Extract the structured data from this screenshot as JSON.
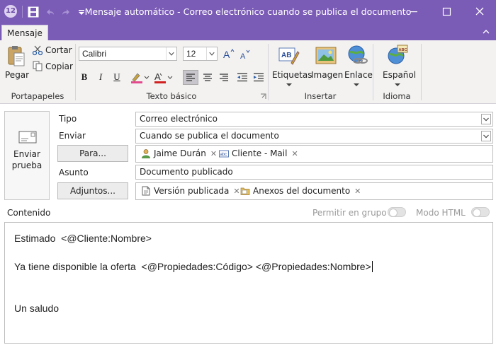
{
  "window": {
    "title": "Mensaje automático - Correo electrónico cuando se publica el documento",
    "app_badge": "12"
  },
  "ribbon": {
    "tab": "Mensaje",
    "clipboard": {
      "paste": "Pegar",
      "cut": "Cortar",
      "copy": "Copiar",
      "group": "Portapapeles"
    },
    "text": {
      "font": "Calibri",
      "size": "12",
      "group": "Texto básico",
      "bold": "B",
      "italic": "I",
      "underline": "U"
    },
    "insert": {
      "labels": "Etiquetas",
      "image": "Imagen",
      "link": "Enlace",
      "group": "Insertar"
    },
    "language": {
      "spanish": "Español",
      "group": "Idioma"
    }
  },
  "form": {
    "send_test": "Enviar prueba",
    "type_label": "Tipo",
    "type_value": "Correo electrónico",
    "send_label": "Enviar",
    "send_value": "Cuando se publica el documento",
    "to_button": "Para...",
    "recipients": [
      {
        "name": "Jaime Durán",
        "icon": "user-icon"
      },
      {
        "name": "Cliente - Mail",
        "icon": "abc-field-icon"
      }
    ],
    "subject_label": "Asunto",
    "subject_value": "Documento publicado",
    "attachments_button": "Adjuntos...",
    "attachments": [
      {
        "name": "Versión publicada",
        "icon": "document-icon"
      },
      {
        "name": "Anexos del documento",
        "icon": "folder-icon"
      }
    ],
    "content_label": "Contenido",
    "group_toggle": "Permitir en grupo",
    "html_toggle": "Modo HTML"
  },
  "body": {
    "line1": "Estimado  <@Cliente:Nombre>",
    "line2": "Ya tiene disponible la oferta  <@Propiedades:Código> <@Propiedades:Nombre>",
    "line3": "Un saludo"
  },
  "colors": {
    "titlebar": "#7a5bb6",
    "ribbon": "#f3f2f1"
  }
}
